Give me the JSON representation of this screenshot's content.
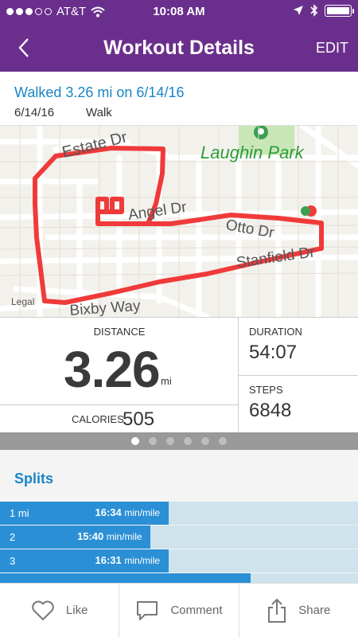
{
  "status_bar": {
    "carrier": "AT&T",
    "time": "10:08 AM"
  },
  "nav": {
    "title": "Workout Details",
    "edit_label": "EDIT"
  },
  "summary": {
    "title": "Walked 3.26 mi on 6/14/16",
    "date": "6/14/16",
    "activity": "Walk"
  },
  "map": {
    "labels": {
      "estate": "Estate Dr",
      "park": "Laughin Park",
      "angel": "Angel Dr",
      "otto": "Otto Dr",
      "stanfield": "Stanfield Dr",
      "bixby": "Bixby Way"
    },
    "legal": "Legal",
    "route_color": "#f03a3a",
    "park_color": "#2e9d3a"
  },
  "stats": {
    "distance_label": "DISTANCE",
    "distance_value": "3.26",
    "distance_unit": "mi",
    "calories_label": "CALORIES",
    "calories_value": "505",
    "duration_label": "DURATION",
    "duration_value": "54:07",
    "steps_label": "STEPS",
    "steps_value": "6848"
  },
  "pager": {
    "count": 6,
    "active": 0
  },
  "splits": {
    "title": "Splits",
    "unit": "min/mile",
    "rows": [
      {
        "label": "1 mi",
        "pace": "16:34",
        "fill": 0.47
      },
      {
        "label": "2",
        "pace": "15:40",
        "fill": 0.42
      },
      {
        "label": "3",
        "pace": "16:31",
        "fill": 0.47
      },
      {
        "label": "",
        "pace": "",
        "fill": 0.7
      }
    ]
  },
  "actions": {
    "like": "Like",
    "comment": "Comment",
    "share": "Share"
  },
  "colors": {
    "header": "#6a2f8c",
    "accent": "#1a86c6",
    "split_bar": "#2b8fd6",
    "split_track": "#cfe3ec"
  }
}
